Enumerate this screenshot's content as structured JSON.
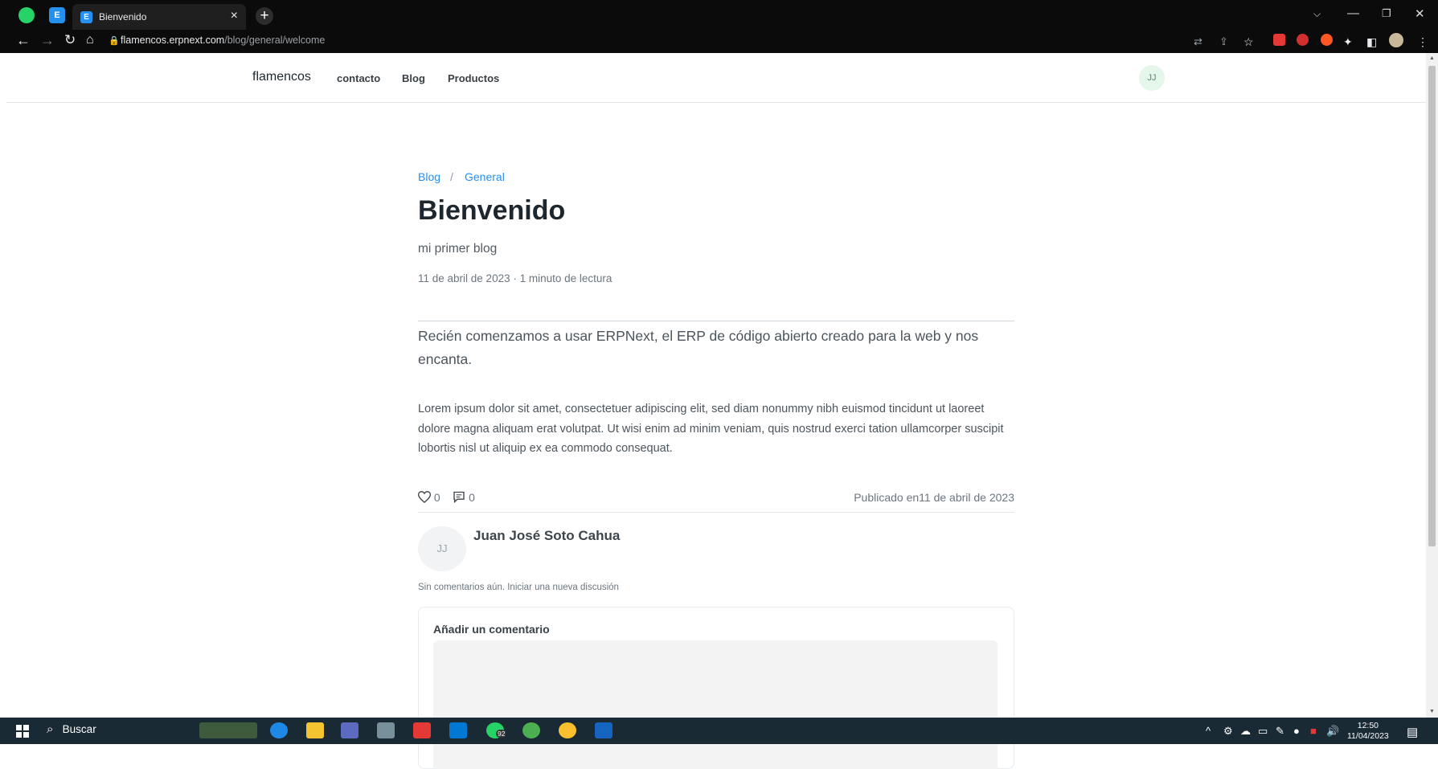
{
  "browser": {
    "tab_title": "Bienvenido",
    "tab_close": "×",
    "new_tab": "+",
    "url_host": "flamencos.erpnext.com",
    "url_path": "/blog/general/welcome"
  },
  "site": {
    "brand": "flamencos",
    "nav": [
      "contacto",
      "Blog",
      "Productos"
    ],
    "user_initials": "JJ"
  },
  "breadcrumb": {
    "items": [
      "Blog",
      "General"
    ],
    "separator": "/"
  },
  "post": {
    "title": "Bienvenido",
    "subtitle": "mi primer blog",
    "meta": "11 de abril de 2023 · 1 minuto de lectura",
    "lead": "Recién comenzamos a usar ERPNext, el ERP de código abierto creado para la web y nos encanta.",
    "body": "Lorem ipsum dolor sit amet, consectetuer adipiscing elit, sed diam nonummy nibh euismod tincidunt ut laoreet dolore magna aliquam erat volutpat. Ut wisi enim ad minim veniam, quis nostrud exerci tation ullamcorper suscipit lobortis nisl ut aliquip ex ea commodo consequat.",
    "likes": "0",
    "comments": "0",
    "published": "Publicado en11 de abril de 2023",
    "author_initials": "JJ",
    "author_name": "Juan José Soto Cahua"
  },
  "comments": {
    "empty_text": "Sin comentarios aún. Iniciar una nueva discusión",
    "add_label": "Añadir un comentario"
  },
  "taskbar": {
    "search_label": "Buscar",
    "whatsapp_badge": "92",
    "time": "12:50",
    "date": "11/04/2023"
  },
  "colors": {
    "link": "#2490ef",
    "text_dark": "#1f272e",
    "avatar_bg": "#e5f6ea"
  }
}
